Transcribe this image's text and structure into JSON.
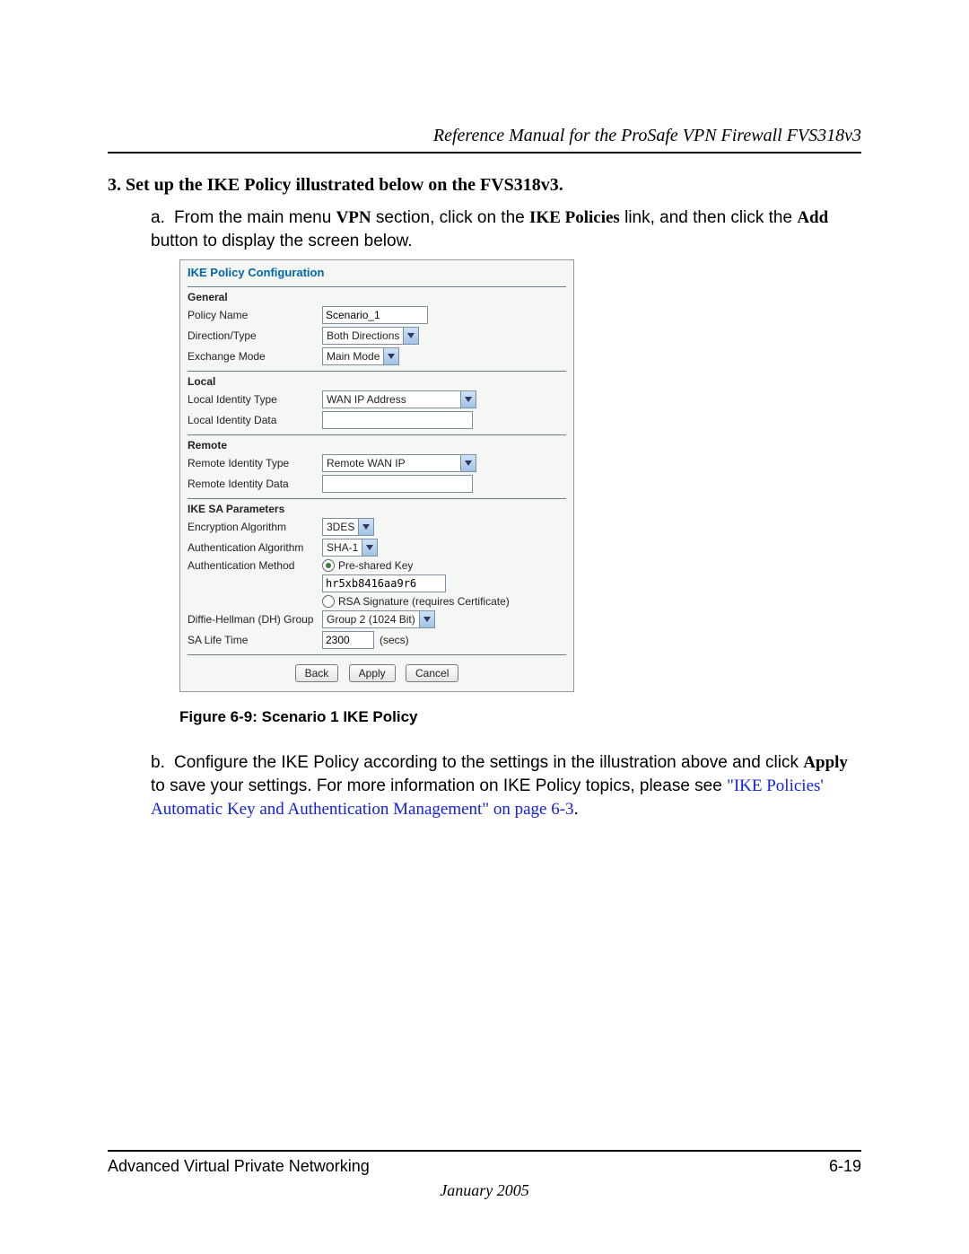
{
  "header": {
    "title": "Reference Manual for the ProSafe VPN Firewall FVS318v3"
  },
  "step": {
    "number": "3.",
    "title": "Set up the IKE Policy illustrated below on the FVS318v3."
  },
  "substep_a": {
    "letter": "a.",
    "t1": "From the main menu ",
    "t2": "VPN",
    "t3": " section, click on the ",
    "t4": "IKE Policies",
    "t5": " link, and then click the ",
    "t6": "Add",
    "t7": " button to display the screen below."
  },
  "shot": {
    "title": "IKE Policy Configuration",
    "general": {
      "head": "General",
      "policy_name_label": "Policy Name",
      "policy_name_value": "Scenario_1",
      "direction_label": "Direction/Type",
      "direction_value": "Both Directions",
      "exchange_label": "Exchange Mode",
      "exchange_value": "Main Mode"
    },
    "local": {
      "head": "Local",
      "type_label": "Local Identity Type",
      "type_value": "WAN IP Address",
      "data_label": "Local Identity Data",
      "data_value": ""
    },
    "remote": {
      "head": "Remote",
      "type_label": "Remote Identity Type",
      "type_value": "Remote WAN IP",
      "data_label": "Remote Identity Data",
      "data_value": ""
    },
    "sa": {
      "head": "IKE SA Parameters",
      "enc_label": "Encryption Algorithm",
      "enc_value": "3DES",
      "auth_alg_label": "Authentication Algorithm",
      "auth_alg_value": "SHA-1",
      "auth_method_label": "Authentication Method",
      "psk_label": "Pre-shared Key",
      "psk_value": "hr5xb8416aa9r6",
      "rsa_label": "RSA Signature (requires Certificate)",
      "dh_label": "Diffie-Hellman (DH) Group",
      "dh_value": "Group 2 (1024 Bit)",
      "life_label": "SA Life Time",
      "life_value": "2300",
      "life_unit": "(secs)"
    },
    "buttons": {
      "back": "Back",
      "apply": "Apply",
      "cancel": "Cancel"
    }
  },
  "figure_caption": "Figure 6-9: Scenario 1 IKE Policy",
  "substep_b": {
    "letter": "b.",
    "t1": "Configure the IKE Policy according to the settings in the illustration above and click ",
    "t2": "Apply",
    "t3": " to save your settings. For more information on IKE Policy topics, please see ",
    "link": "\"IKE Policies' Automatic Key and Authentication Management\" on page 6-3",
    "t4": "."
  },
  "footer": {
    "left": "Advanced Virtual Private Networking",
    "right": "6-19",
    "date": "January 2005"
  }
}
